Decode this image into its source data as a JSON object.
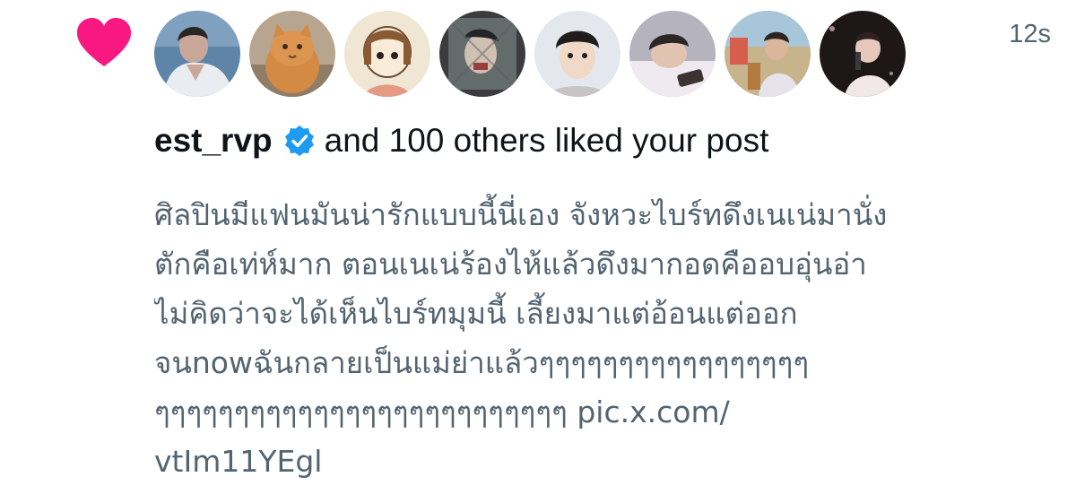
{
  "notification": {
    "type_icon": "heart-icon",
    "heart_color": "#f91880",
    "timestamp": "12s",
    "username": "est_rvp",
    "verified_icon": "verified-badge-icon",
    "verified_color": "#1d9bf0",
    "liked_text": "and 100 others liked your post",
    "avatars": [
      {
        "name": "avatar-1",
        "kind": "photo"
      },
      {
        "name": "avatar-2",
        "kind": "cat"
      },
      {
        "name": "avatar-3",
        "kind": "cartoon"
      },
      {
        "name": "avatar-4",
        "kind": "photo"
      },
      {
        "name": "avatar-5",
        "kind": "photo"
      },
      {
        "name": "avatar-6",
        "kind": "photo"
      },
      {
        "name": "avatar-7",
        "kind": "photo"
      },
      {
        "name": "avatar-8",
        "kind": "photo"
      }
    ],
    "post_lines": [
      "ศิลปินมีแฟนมันน่ารักแบบนี้นี่เอง จังหวะไบร์ทดึงเนเน่มานั่ง",
      "ตักคือเท่ห์มาก ตอนเนเน่ร้องไห้แล้วดึงมากอดคืออบอุ่นอ่า",
      "ไม่คิดว่าจะได้เห็นไบร์ทมุมนี้ เลี้ยงมาแต่อ้อนแต่ออก",
      "จนnowฉันกลายเป็นแม่ย่าแล้วๆๆๆๆๆๆๆๆๆๆๆๆๆๆๆๆๆ"
    ],
    "post_line_5": "ๆๆๆๆๆๆๆๆๆๆๆๆๆๆๆๆๆๆๆๆๆๆๆๆๆๆ",
    "link_part_1": "pic.x.com/",
    "link_part_2": "vtIm11YEgl"
  }
}
